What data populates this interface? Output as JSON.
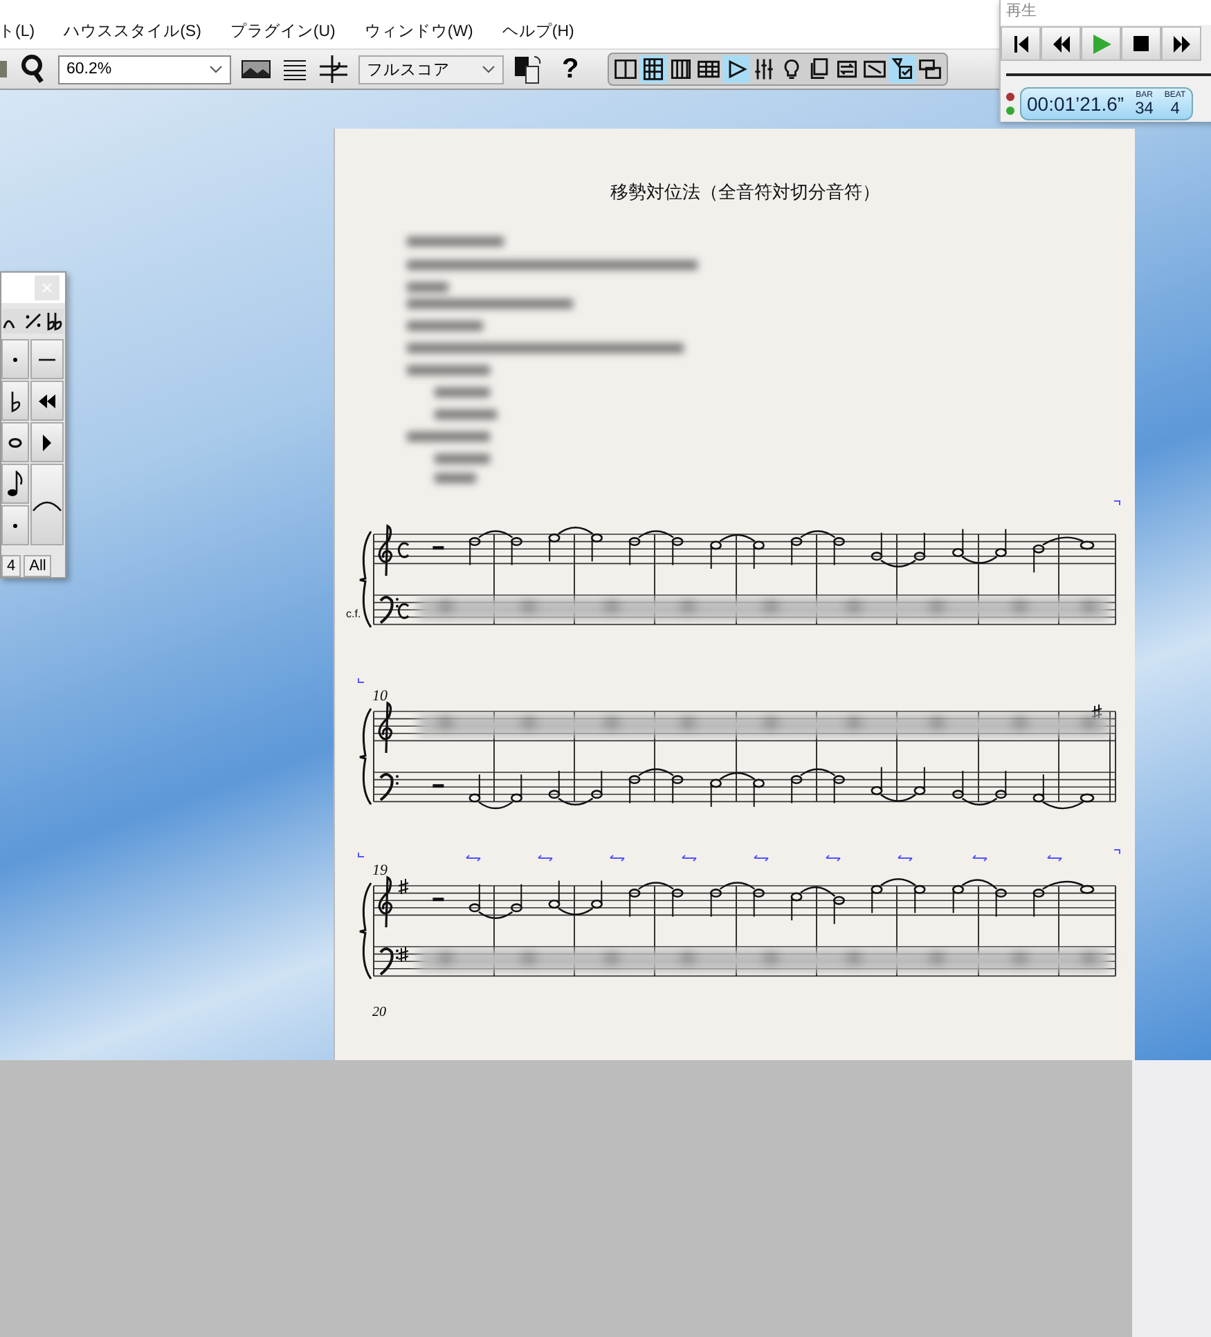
{
  "menu": [
    "ト(L)",
    "ハウススタイル(S)",
    "プラグイン(U)",
    "ウィンドウ(W)",
    "ヘルプ(H)"
  ],
  "toolbar": {
    "zoom": "60.2%",
    "view": "フルスコア",
    "help": "?",
    "view_buttons": [
      {
        "selected": false
      },
      {
        "selected": true
      },
      {
        "selected": false
      },
      {
        "selected": false
      },
      {
        "selected": true
      },
      {
        "selected": false
      },
      {
        "selected": false
      },
      {
        "selected": false
      },
      {
        "selected": false
      },
      {
        "selected": false
      },
      {
        "selected": true
      },
      {
        "selected": false
      }
    ]
  },
  "playback": {
    "title": "再生",
    "time": "00:01’21.6”",
    "bar_label": "BAR",
    "bar": "34",
    "beat_label": "BEAT",
    "beat": "4"
  },
  "palette": {
    "buttons": [
      "4",
      "All"
    ]
  },
  "score": {
    "title": "移勢対位法（全音符対切分音符）",
    "systems": [
      {
        "staff_label": "c.f."
      },
      {
        "measure_number": "10"
      },
      {
        "measure_number": "19"
      }
    ],
    "next_measure_number": "20"
  }
}
